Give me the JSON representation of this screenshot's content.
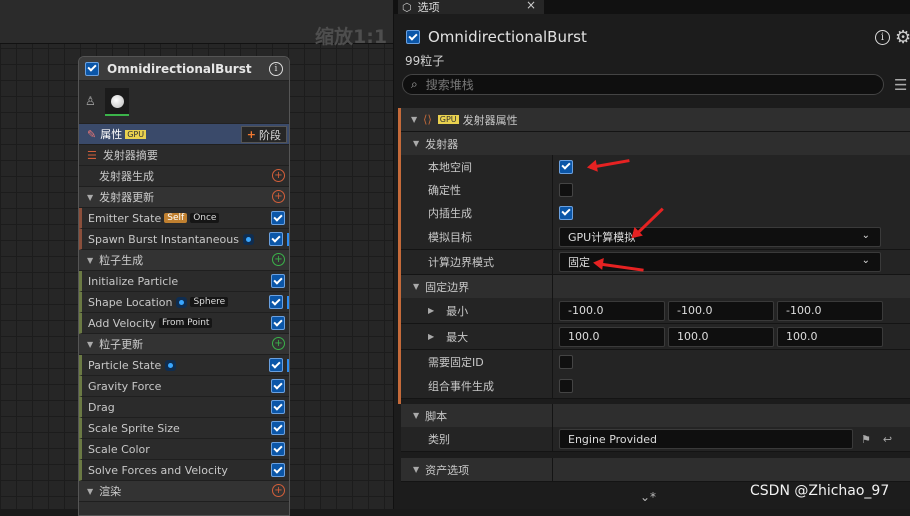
{
  "graph": {
    "zoom_label": "缩放1:1"
  },
  "node": {
    "title": "OmnidirectionalBurst",
    "props_label": "属性",
    "gpu_tag": "GPU",
    "stage_button": "阶段",
    "rows": {
      "summary": "发射器摘要",
      "emitter_spawn": "发射器生成",
      "emitter_update": "发射器更新",
      "emitter_state": "Emitter State",
      "self_tag": "Self",
      "once_tag": "Once",
      "spawn_burst": "Spawn Burst Instantaneous",
      "particle_spawn": "粒子生成",
      "init_particle": "Initialize Particle",
      "shape_location": "Shape Location",
      "sphere_tag": "Sphere",
      "add_velocity": "Add Velocity",
      "from_point_tag": "From Point",
      "particle_update": "粒子更新",
      "particle_state": "Particle State",
      "gravity_force": "Gravity Force",
      "drag": "Drag",
      "scale_sprite_size": "Scale Sprite Size",
      "scale_color": "Scale Color",
      "solve_forces": "Solve Forces and Velocity",
      "render": "渲染"
    }
  },
  "panel": {
    "tab_label": "选项",
    "emitter_name": "OmnidirectionalBurst",
    "particle_count": "99粒子",
    "search_placeholder": "搜索堆栈",
    "section_title": "发射器属性",
    "section_gpu": "GPU",
    "cat_emitter": "发射器",
    "local_space": "本地空间",
    "deterministic": "确定性",
    "interpolated_spawn": "内插生成",
    "sim_target": "模拟目标",
    "sim_target_value": "GPU计算模拟",
    "bounds_mode": "计算边界模式",
    "bounds_mode_value": "固定",
    "fixed_bounds": "固定边界",
    "min_label": "最小",
    "min_values": [
      "-100.0",
      "-100.0",
      "-100.0"
    ],
    "max_label": "最大",
    "max_values": [
      "100.0",
      "100.0",
      "100.0"
    ],
    "requires_persistent_id": "需要固定ID",
    "combine_event_spawn": "组合事件生成",
    "cat_script": "脚本",
    "category_label": "类别",
    "category_value": "Engine Provided",
    "cat_asset": "资产选项",
    "footer_chevron": "⌄*"
  },
  "watermark": "CSDN @Zhichao_97",
  "colors": {
    "accent": "#0b56a8",
    "annotation_arrow": "#e62222",
    "section_bar": "#c46a3a"
  }
}
